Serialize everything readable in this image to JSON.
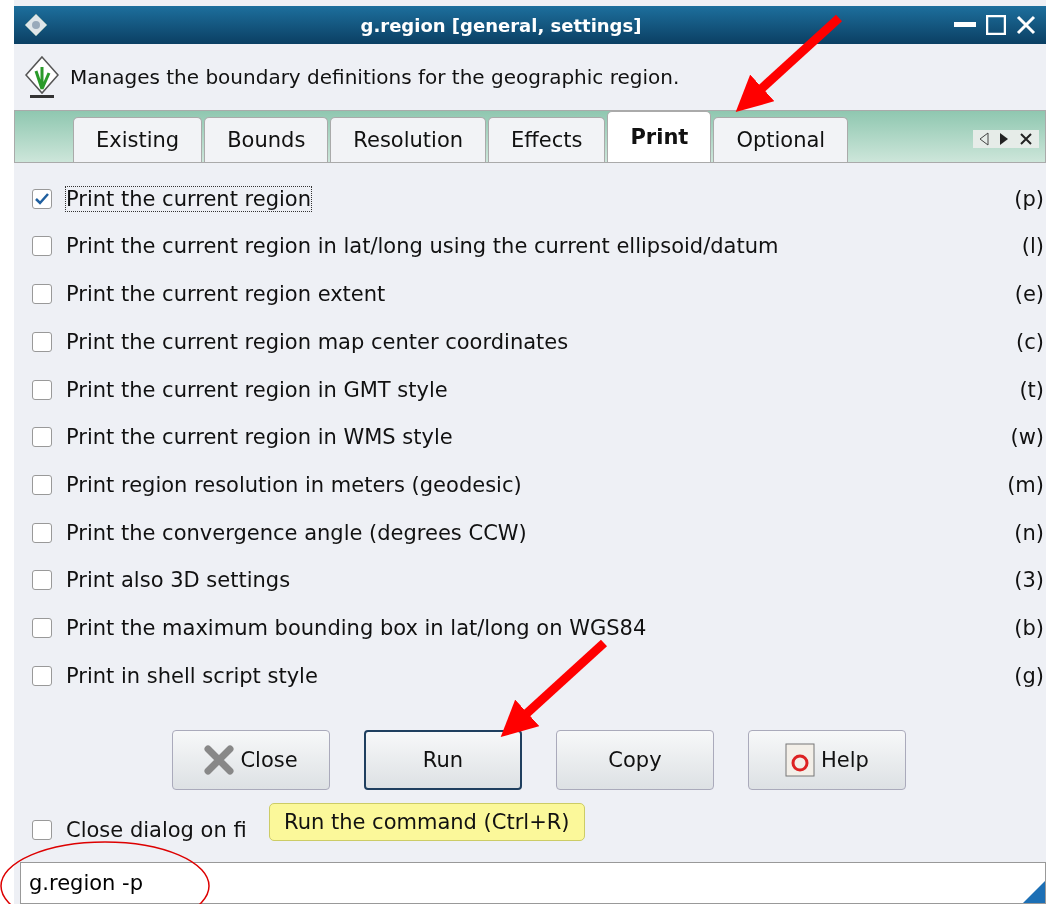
{
  "window": {
    "title": "g.region [general, settings]"
  },
  "description": "Manages the boundary definitions for the geographic region.",
  "tabs": [
    {
      "label": "Existing",
      "selected": false
    },
    {
      "label": "Bounds",
      "selected": false
    },
    {
      "label": "Resolution",
      "selected": false
    },
    {
      "label": "Effects",
      "selected": false
    },
    {
      "label": "Print",
      "selected": true
    },
    {
      "label": "Optional",
      "selected": false
    }
  ],
  "options": [
    {
      "label": "Print the current region",
      "flag": "(p)",
      "checked": true
    },
    {
      "label": "Print the current region in lat/long using the current ellipsoid/datum",
      "flag": "(l)",
      "checked": false
    },
    {
      "label": "Print the current region extent",
      "flag": "(e)",
      "checked": false
    },
    {
      "label": "Print the current region map center coordinates",
      "flag": "(c)",
      "checked": false
    },
    {
      "label": "Print the current region in GMT style",
      "flag": "(t)",
      "checked": false
    },
    {
      "label": "Print the current region in WMS style",
      "flag": "(w)",
      "checked": false
    },
    {
      "label": "Print region resolution in meters (geodesic)",
      "flag": "(m)",
      "checked": false
    },
    {
      "label": "Print the convergence angle (degrees CCW)",
      "flag": "(n)",
      "checked": false
    },
    {
      "label": "Print also 3D settings",
      "flag": "(3)",
      "checked": false
    },
    {
      "label": "Print the maximum bounding box in lat/long on WGS84",
      "flag": "(b)",
      "checked": false
    },
    {
      "label": "Print in shell script style",
      "flag": "(g)",
      "checked": false
    }
  ],
  "buttons": [
    {
      "label": "Close",
      "kind": "close",
      "focused": false
    },
    {
      "label": "Run",
      "kind": "plain",
      "focused": true
    },
    {
      "label": "Copy",
      "kind": "plain",
      "focused": false
    },
    {
      "label": "Help",
      "kind": "help",
      "focused": false
    }
  ],
  "close_on_finish": {
    "label": "Close dialog on fi",
    "checked": false
  },
  "tooltip": "Run the command (Ctrl+R)",
  "command": "g.region -p"
}
